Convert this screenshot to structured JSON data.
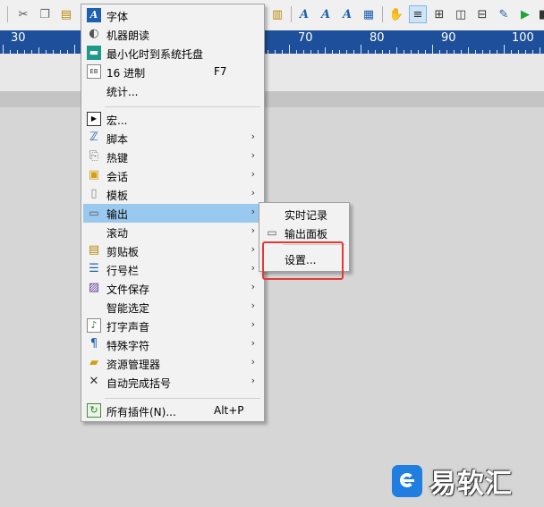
{
  "ruler": {
    "labels": [
      "30",
      "70",
      "80",
      "90",
      "100"
    ]
  },
  "menu": {
    "items": [
      {
        "label": "字体",
        "shortcut": "",
        "submenu": false,
        "icon": "font-icon"
      },
      {
        "label": "机器朗读",
        "shortcut": "",
        "submenu": false,
        "icon": "speaker-icon"
      },
      {
        "label": "最小化时到系统托盘",
        "shortcut": "",
        "submenu": false,
        "icon": "tray-icon"
      },
      {
        "label": "16 进制",
        "shortcut": "F7",
        "submenu": false,
        "icon": "hex-icon"
      },
      {
        "label": "统计...",
        "shortcut": "",
        "submenu": false,
        "icon": ""
      },
      {
        "label": "宏...",
        "shortcut": "",
        "submenu": false,
        "icon": "macro-icon"
      },
      {
        "label": "脚本",
        "shortcut": "",
        "submenu": true,
        "icon": "script-icon"
      },
      {
        "label": "热键",
        "shortcut": "",
        "submenu": true,
        "icon": "hotkey-icon"
      },
      {
        "label": "会话",
        "shortcut": "",
        "submenu": true,
        "icon": "session-icon"
      },
      {
        "label": "模板",
        "shortcut": "",
        "submenu": true,
        "icon": "template-icon"
      },
      {
        "label": "输出",
        "shortcut": "",
        "submenu": true,
        "icon": "output-icon"
      },
      {
        "label": "滚动",
        "shortcut": "",
        "submenu": true,
        "icon": ""
      },
      {
        "label": "剪贴板",
        "shortcut": "",
        "submenu": true,
        "icon": "clipboard-icon"
      },
      {
        "label": "行号栏",
        "shortcut": "",
        "submenu": true,
        "icon": "line-numbers-icon"
      },
      {
        "label": "文件保存",
        "shortcut": "",
        "submenu": true,
        "icon": "file-save-icon"
      },
      {
        "label": "智能选定",
        "shortcut": "",
        "submenu": true,
        "icon": ""
      },
      {
        "label": "打字声音",
        "shortcut": "",
        "submenu": true,
        "icon": "music-note-icon"
      },
      {
        "label": "特殊字符",
        "shortcut": "",
        "submenu": true,
        "icon": "pilcrow-icon"
      },
      {
        "label": "资源管理器",
        "shortcut": "",
        "submenu": true,
        "icon": "folder-icon"
      },
      {
        "label": "自动完成括号",
        "shortcut": "",
        "submenu": true,
        "icon": "brackets-icon"
      },
      {
        "label": "所有插件(N)...",
        "shortcut": "Alt+P",
        "submenu": false,
        "icon": "plugins-icon"
      }
    ]
  },
  "submenu": {
    "items": [
      {
        "label": "实时记录"
      },
      {
        "label": "输出面板"
      },
      {
        "label": "设置..."
      }
    ]
  },
  "watermark": {
    "text": "易软汇"
  },
  "colors": {
    "highlight": "#99c9ef",
    "ruler": "#1e4f9a",
    "annotation": "#e53935"
  }
}
